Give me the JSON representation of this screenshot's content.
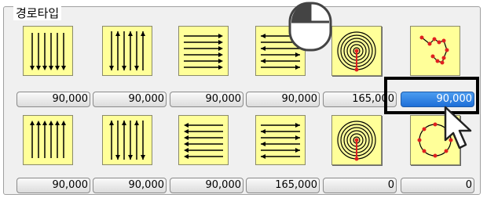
{
  "group": {
    "title": "경로타입"
  },
  "patterns": [
    {
      "name": "vertical-down-lines",
      "value": "90,000"
    },
    {
      "name": "vertical-alternating-lines",
      "value": "90,000"
    },
    {
      "name": "horizontal-right-lines",
      "value": "90,000"
    },
    {
      "name": "horizontal-alternating-lines",
      "value": "90,000"
    },
    {
      "name": "spiral-inward",
      "value": "165,000"
    },
    {
      "name": "random-path",
      "value": "90,000"
    },
    {
      "name": "vertical-up-lines",
      "value": "90,000"
    },
    {
      "name": "vertical-alternating-lines-2",
      "value": "90,000"
    },
    {
      "name": "horizontal-left-lines",
      "value": "90,000"
    },
    {
      "name": "horizontal-alternating-lines-2",
      "value": "165,000"
    },
    {
      "name": "spiral-outward",
      "value": "0"
    },
    {
      "name": "circle-path",
      "value": "0"
    }
  ],
  "selected_index": 5,
  "icons": {
    "mouse": "mouse-left-click-icon",
    "cursor": "arrow-cursor-icon"
  },
  "colors": {
    "tile": "#ffff99",
    "selected": "#1e6fd8",
    "red_dot": "#e02020"
  }
}
